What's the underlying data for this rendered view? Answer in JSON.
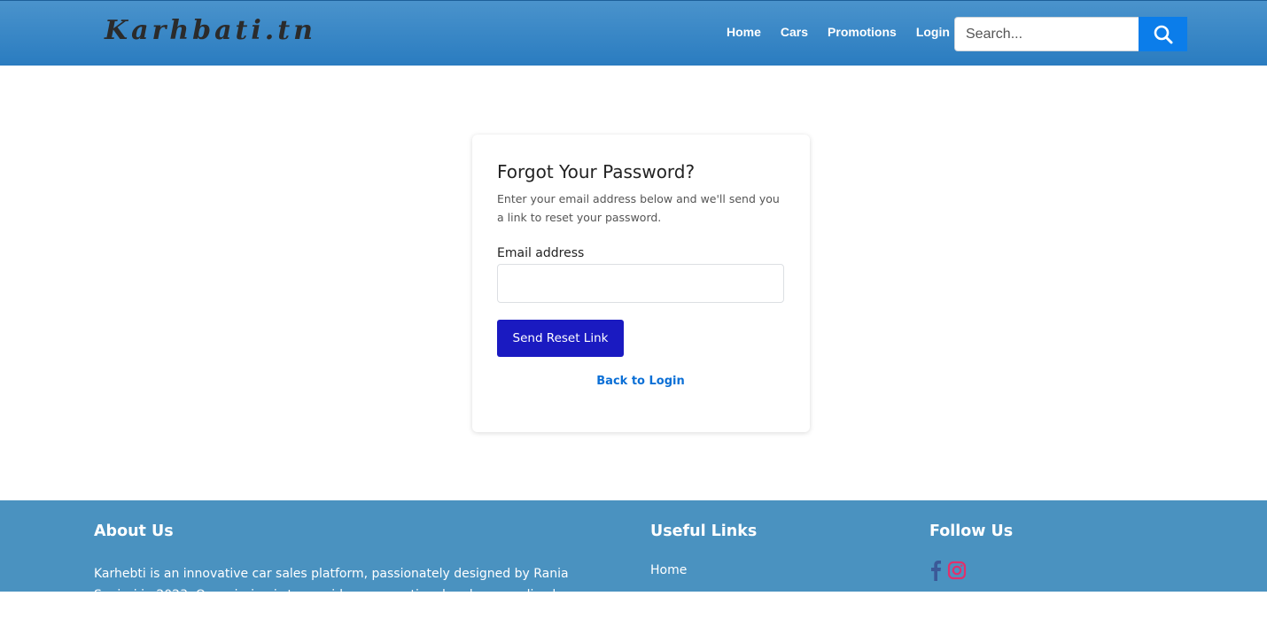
{
  "navbar": {
    "logo": "Karhbati.tn",
    "links": [
      "Home",
      "Cars",
      "Promotions",
      "Login"
    ],
    "search_placeholder": "Search..."
  },
  "card": {
    "title": "Forgot Your Password?",
    "description": "Enter your email address below and we'll send you a link to reset your password.",
    "email_label": "Email address",
    "email_value": "",
    "submit_label": "Send Reset Link",
    "back_link": "Back to Login"
  },
  "footer": {
    "about_heading": "About Us",
    "about_text": "Karhebti is an innovative car sales platform, passionately designed by Rania Souissi in 2023. Our mission is to provide an exceptional and personalized car buying experience.",
    "links_heading": "Useful Links",
    "links": [
      "Home"
    ],
    "follow_heading": "Follow Us"
  },
  "colors": {
    "navbar": "#2a7cc0",
    "button": "#1a1ac1",
    "link": "#0b6fd6",
    "footer": "#4a92c0",
    "facebook": "#3b5998",
    "instagram": "#e1306c"
  }
}
